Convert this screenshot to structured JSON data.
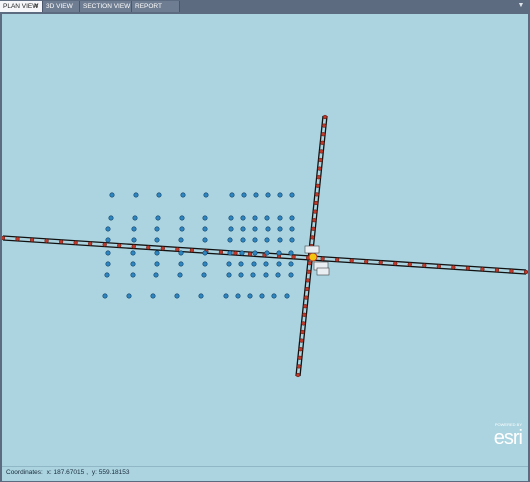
{
  "tabs": [
    {
      "label": "PLAN VIEW",
      "active": true,
      "closable": true
    },
    {
      "label": "3D VIEW",
      "active": false,
      "closable": false
    },
    {
      "label": "SECTION VIEW",
      "active": false,
      "closable": false
    },
    {
      "label": "REPORT VIEW",
      "active": false,
      "closable": false
    }
  ],
  "tab_close_icon": "close-icon",
  "tab_menu_icon": "chevron-down-icon",
  "map": {
    "background_color": "#abd4e0",
    "line_color": "#111111",
    "node_color": "#c0392b",
    "node_fill_highlight": "#f1c40f",
    "point_color": "#2e86c1"
  },
  "status": {
    "label": "Coordinates:",
    "x_text": "x: 187.67015",
    "y_text": "y: 559.18153"
  },
  "logo": {
    "top_text": "POWERED BY",
    "brand": "esri"
  }
}
